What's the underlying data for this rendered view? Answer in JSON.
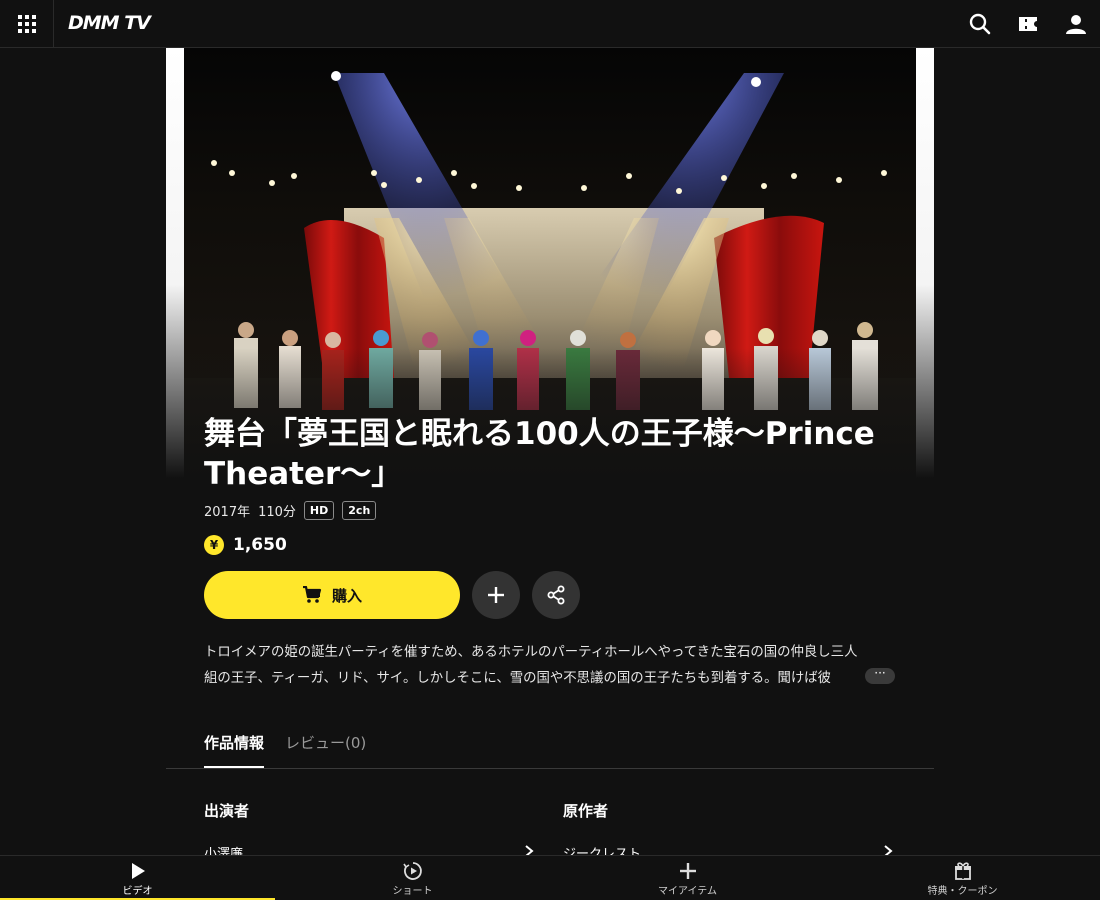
{
  "header": {
    "logo": "DMM TV",
    "icons": [
      "apps-grid-icon",
      "search-icon",
      "ticket-icon",
      "user-icon"
    ]
  },
  "work": {
    "title": "舞台「夢王国と眠れる100人の王子様〜Prince Theater〜」",
    "year": "2017年",
    "duration": "110分",
    "tags": [
      "HD",
      "2ch"
    ],
    "price": "1,650",
    "price_currency_symbol": "¥",
    "buy_label": "購入",
    "description_line1": "トロイメアの姫の誕生パーティを催すため、あるホテルのパーティホールへやってきた宝石の国の仲良し三人",
    "description_line2": "組の王子、ティーガ、リド、サイ。しかしそこに、雪の国や不思議の国の王子たちも到着する。聞けば彼",
    "more_label": "···"
  },
  "tabs": [
    {
      "label": "作品情報",
      "active": true
    },
    {
      "label": "レビュー(0)",
      "active": false
    }
  ],
  "info": {
    "cast_heading": "出演者",
    "cast_first": "小澤廉",
    "original_heading": "原作者",
    "original_first": "ジークレスト"
  },
  "bottom_nav": [
    {
      "label": "ビデオ",
      "icon": "play-icon",
      "active": true
    },
    {
      "label": "ショート",
      "icon": "short-icon",
      "active": false
    },
    {
      "label": "マイアイテム",
      "icon": "plus-icon",
      "active": false
    },
    {
      "label": "特典・クーポン",
      "icon": "gift-icon",
      "active": false
    }
  ],
  "colors": {
    "background": "#111111",
    "accent": "#ffe72b",
    "round_button": "#333333"
  }
}
